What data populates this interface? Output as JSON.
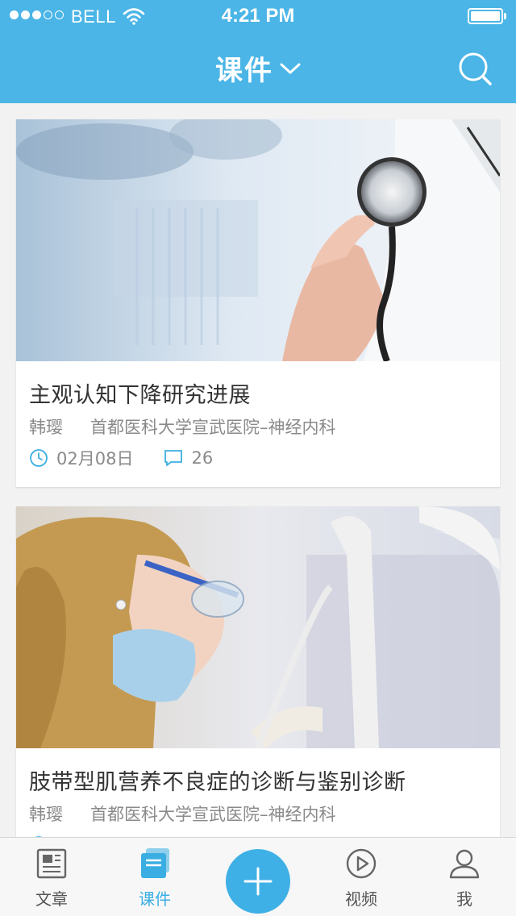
{
  "status_bar": {
    "carrier": "BELL",
    "time": "4:21 PM",
    "signal_dots_filled": 3,
    "signal_dots_total": 5
  },
  "nav": {
    "title": "课件",
    "dropdown_icon": "chevron-down-icon",
    "search_icon": "search-icon"
  },
  "cards": [
    {
      "title": "主观认知下降研究进展",
      "author": "韩璎",
      "institution": "首都医科大学宣武医院–神经内科",
      "date": "02月08日",
      "comments": "26",
      "image": "doctor-stethoscope-photo"
    },
    {
      "title": "肢带型肌营养不良症的诊断与鉴别诊断",
      "author": "韩璎",
      "institution": "首都医科大学宣武医院–神经内科",
      "image": "dentist-mask-photo"
    }
  ],
  "tabbar": {
    "items": [
      {
        "label": "文章",
        "icon": "article-icon"
      },
      {
        "label": "课件",
        "icon": "courseware-icon",
        "active": true
      },
      {
        "label": "视频",
        "icon": "play-icon"
      },
      {
        "label": "我",
        "icon": "user-icon"
      }
    ],
    "fab_icon": "plus-icon"
  },
  "colors": {
    "accent": "#4ab5e6",
    "active_tab": "#3aaee2",
    "text": "#333333",
    "muted": "#8a8a8a",
    "background": "#f2f2f2"
  }
}
